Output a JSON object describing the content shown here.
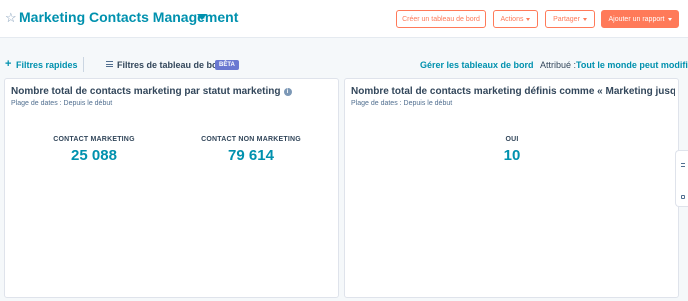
{
  "header": {
    "title": "Marketing Contacts Management",
    "create_dashboard": "Créer un tableau de bord",
    "actions": "Actions",
    "share": "Partager",
    "add_report": "Ajouter un rapport"
  },
  "filterbar": {
    "quick_filters": "Filtres rapides",
    "dashboard_filters": "Filtres de tableau de bord",
    "beta": "BÊTA",
    "manage_dashboards": "Gérer les tableaux de bord",
    "assigned_label": "Attribué :",
    "assigned_value": "Tout le monde peut modifier"
  },
  "cards": [
    {
      "title": "Nombre total de contacts marketing par statut marketing",
      "subtitle": "Plage de dates : Depuis le début",
      "metrics": [
        {
          "label": "CONTACT MARKETING",
          "value": "25 088"
        },
        {
          "label": "CONTACT NON MARKETING",
          "value": "79 614"
        }
      ]
    },
    {
      "title": "Nombre total de contacts marketing définis comme « Marketing jusqu...",
      "subtitle": "Plage de dates : Depuis le début",
      "metrics": [
        {
          "label": "OUI",
          "value": "10"
        }
      ]
    }
  ],
  "colors": {
    "accent": "#0091ae",
    "brand_orange": "#ff7a59",
    "beta_badge": "#6a78d1",
    "text": "#33475b"
  },
  "icons": [
    "star-icon",
    "caret-down-icon",
    "plus-icon",
    "filter-lines-icon",
    "info-icon"
  ]
}
